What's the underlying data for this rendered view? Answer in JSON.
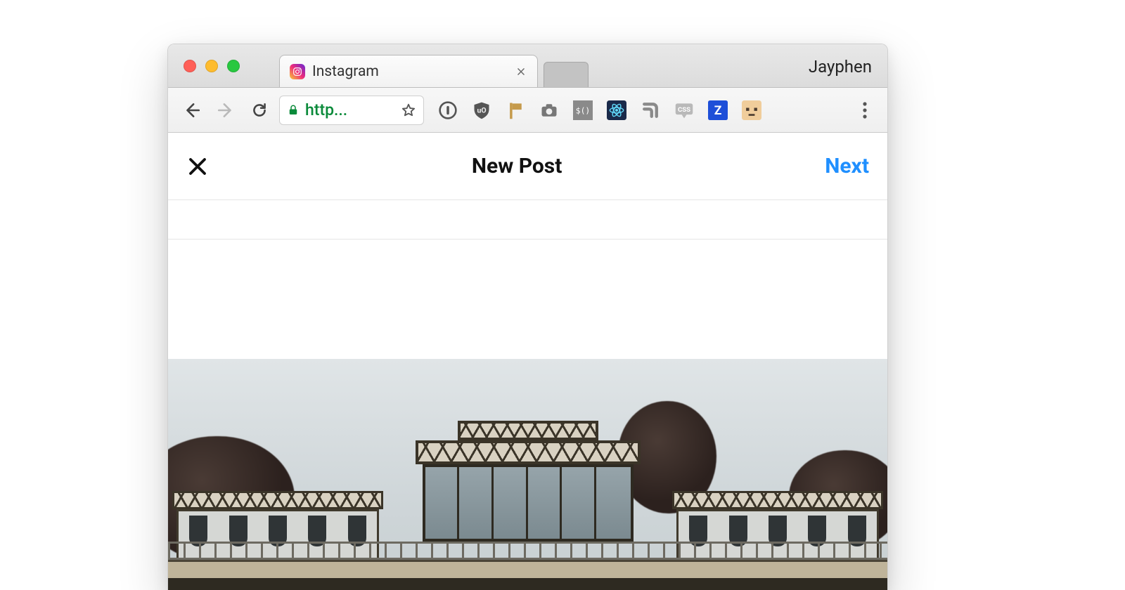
{
  "window": {
    "profile": "Jayphen"
  },
  "tab": {
    "title": "Instagram"
  },
  "omnibox": {
    "url_display": "http..."
  },
  "extensions": {
    "onepassword": "1Password",
    "ublock": "uBlock Origin",
    "flag": "Flag extension",
    "camera": "Screenshot",
    "jquery": "jQuery console",
    "react": "React DevTools",
    "feedly": "Feedly",
    "css": "CSS viewer",
    "zeplin": "Zeplin",
    "toggl": "Toggl"
  },
  "instagram": {
    "header_title": "New Post",
    "next_label": "Next"
  }
}
